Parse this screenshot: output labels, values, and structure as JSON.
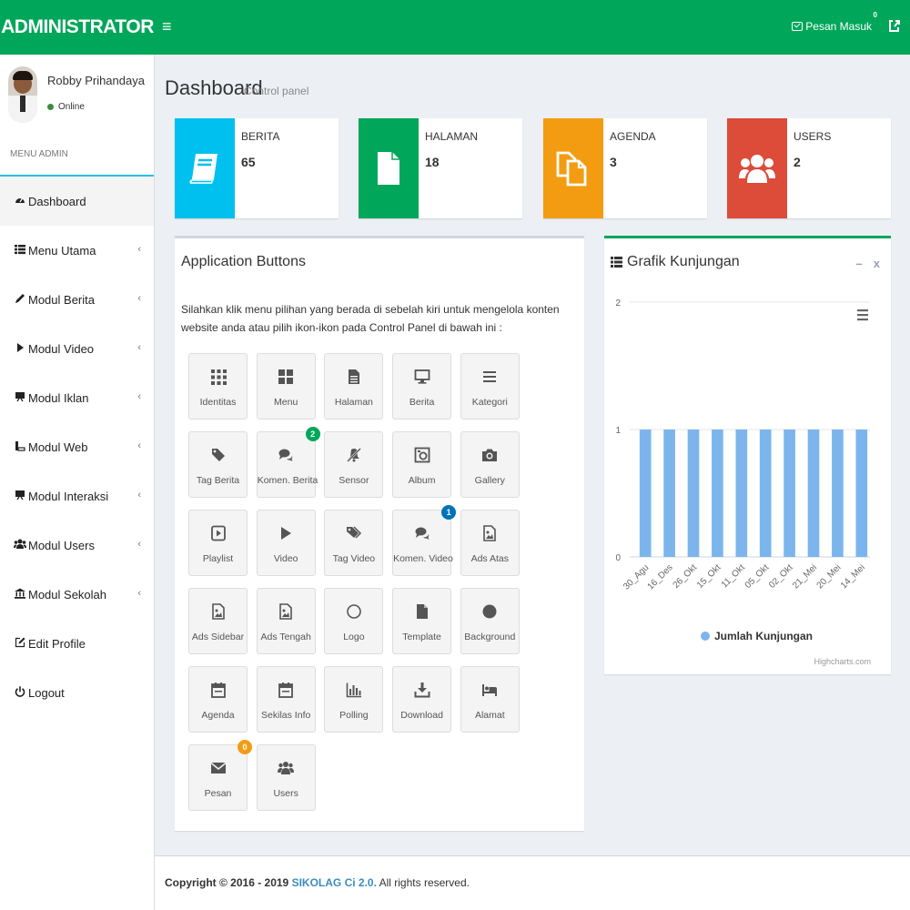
{
  "header": {
    "logo": "ADMINISTRATOR",
    "messages_label": "Pesan Masuk",
    "messages_count": "0"
  },
  "user": {
    "name": "Robby Prihandaya",
    "status": "Online"
  },
  "sidebar": {
    "header": "MENU ADMIN",
    "items": [
      {
        "label": "Dashboard"
      },
      {
        "label": "Menu Utama"
      },
      {
        "label": "Modul Berita"
      },
      {
        "label": "Modul Video"
      },
      {
        "label": "Modul Iklan"
      },
      {
        "label": "Modul Web"
      },
      {
        "label": "Modul Interaksi"
      },
      {
        "label": "Modul Users"
      },
      {
        "label": "Modul Sekolah"
      },
      {
        "label": "Edit Profile"
      },
      {
        "label": "Logout"
      }
    ]
  },
  "page": {
    "title": "Dashboard",
    "subtitle": "Control panel"
  },
  "info_boxes": [
    {
      "label": "BERITA",
      "value": "65",
      "color": "#00c0ef",
      "icon": "book-icon"
    },
    {
      "label": "HALAMAN",
      "value": "18",
      "color": "#00a65a",
      "icon": "file-icon"
    },
    {
      "label": "AGENDA",
      "value": "3",
      "color": "#f39c12",
      "icon": "copy-icon"
    },
    {
      "label": "USERS",
      "value": "2",
      "color": "#dd4b39",
      "icon": "users-icon"
    }
  ],
  "app_box": {
    "title": "Application Buttons",
    "description": "Silahkan klik menu pilihan yang berada di sebelah kiri untuk mengelola konten website anda atau pilih ikon-ikon pada Control Panel di bawah ini :",
    "buttons": [
      {
        "label": "Identitas",
        "icon": "grid-icon"
      },
      {
        "label": "Menu",
        "icon": "th-large-icon"
      },
      {
        "label": "Halaman",
        "icon": "file-text-icon"
      },
      {
        "label": "Berita",
        "icon": "monitor-icon"
      },
      {
        "label": "Kategori",
        "icon": "list-icon"
      },
      {
        "label": "Tag Berita",
        "icon": "tag-icon"
      },
      {
        "label": "Komen. Berita",
        "icon": "comments-icon",
        "badge": "2",
        "badge_color": "#00a65a"
      },
      {
        "label": "Sensor",
        "icon": "mute-icon"
      },
      {
        "label": "Album",
        "icon": "album-icon"
      },
      {
        "label": "Gallery",
        "icon": "camera-icon"
      },
      {
        "label": "Playlist",
        "icon": "playlist-icon"
      },
      {
        "label": "Video",
        "icon": "play-icon"
      },
      {
        "label": "Tag Video",
        "icon": "tags-icon"
      },
      {
        "label": "Komen. Video",
        "icon": "comments-icon",
        "badge": "1",
        "badge_color": "#0073b7"
      },
      {
        "label": "Ads Atas",
        "icon": "image-icon"
      },
      {
        "label": "Ads Sidebar",
        "icon": "image-icon"
      },
      {
        "label": "Ads Tengah",
        "icon": "image-icon"
      },
      {
        "label": "Logo",
        "icon": "circle-icon"
      },
      {
        "label": "Template",
        "icon": "file-icon"
      },
      {
        "label": "Background",
        "icon": "circle-fill-icon"
      },
      {
        "label": "Agenda",
        "icon": "calendar-icon"
      },
      {
        "label": "Sekilas Info",
        "icon": "calendar-icon"
      },
      {
        "label": "Polling",
        "icon": "bar-chart-icon"
      },
      {
        "label": "Download",
        "icon": "download-icon"
      },
      {
        "label": "Alamat",
        "icon": "bed-icon"
      },
      {
        "label": "Pesan",
        "icon": "envelope-icon",
        "badge": "0",
        "badge_color": "#f39c12"
      },
      {
        "label": "Users",
        "icon": "users-icon"
      }
    ]
  },
  "chart_box": {
    "title": "Grafik Kunjungan",
    "minimize": "–",
    "close": "x",
    "credits": "Highcharts.com"
  },
  "chart_data": {
    "type": "bar",
    "title": "",
    "categories": [
      "30_Agu",
      "16_Des",
      "26_Okt",
      "15_Okt",
      "11_Okt",
      "05_Okt",
      "02_Okt",
      "21_Mei",
      "20_Mei",
      "14_Mei"
    ],
    "series": [
      {
        "name": "Jumlah Kunjungan",
        "values": [
          1,
          1,
          1,
          1,
          1,
          1,
          1,
          1,
          1,
          1
        ],
        "color": "#7cb5ec"
      }
    ],
    "ylim": [
      0,
      2
    ],
    "yticks": [
      0,
      1,
      2
    ],
    "grid": true,
    "legend": "bottom"
  },
  "footer": {
    "prefix": "Copyright © 2016 - 2019 ",
    "link": "SIKOLAG Ci 2.0.",
    "suffix": " All rights reserved."
  }
}
